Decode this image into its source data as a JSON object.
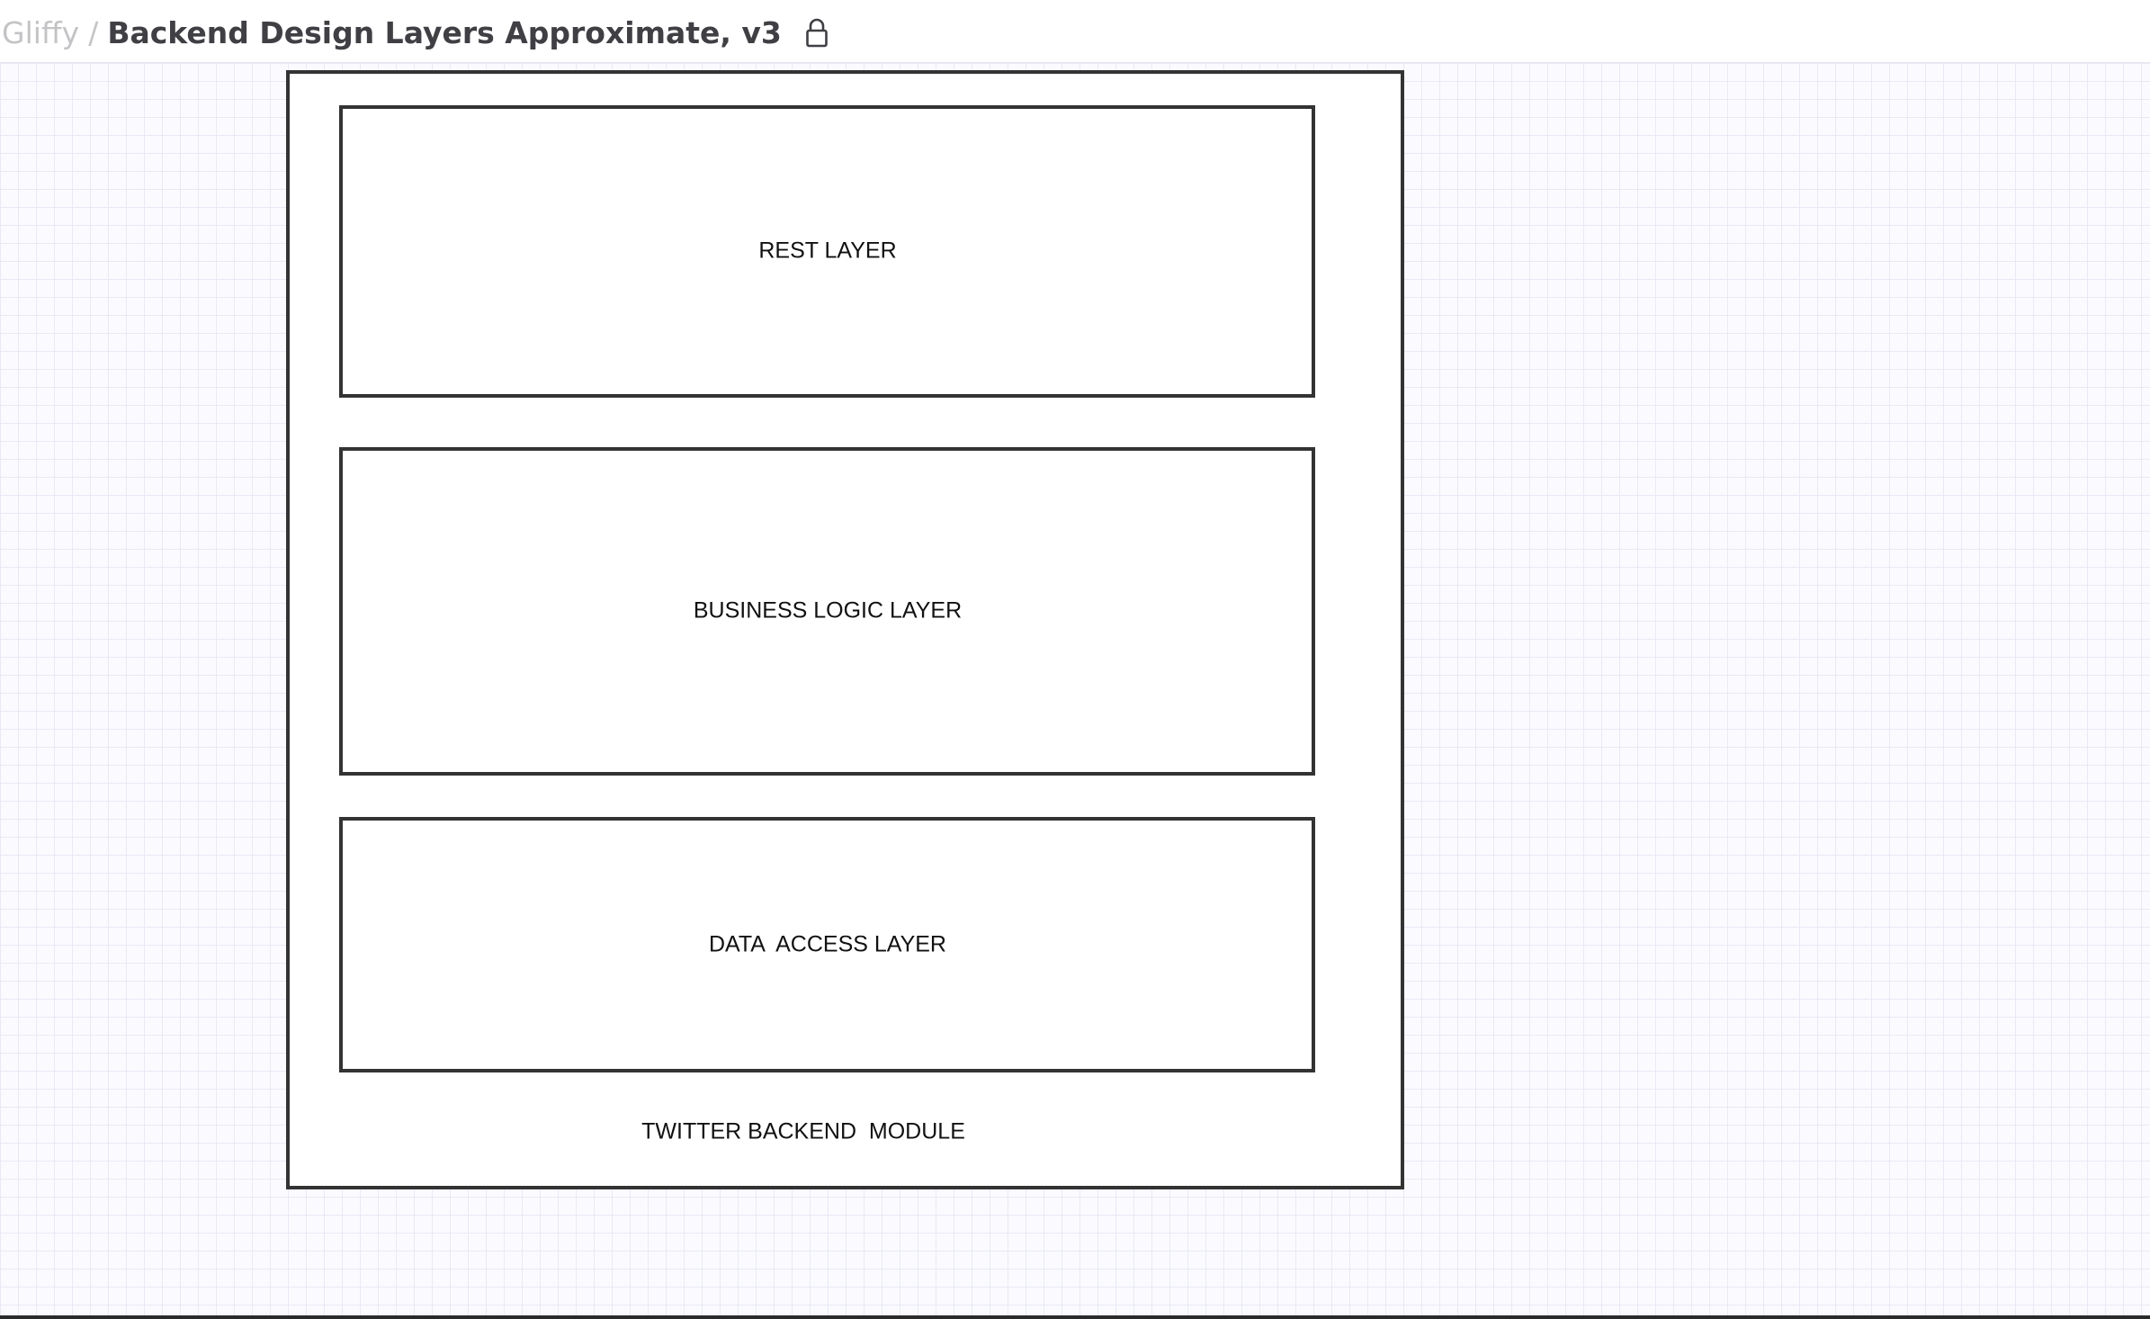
{
  "header": {
    "root_label": "Gliffy",
    "separator": "/",
    "title": "Backend Design Layers Approximate, v3",
    "lock_icon": "lock-icon"
  },
  "diagram": {
    "module_label": "TWITTER BACKEND  MODULE",
    "layers": [
      {
        "label": "REST LAYER"
      },
      {
        "label": "BUSINESS LOGIC LAYER"
      },
      {
        "label": "DATA  ACCESS LAYER"
      }
    ]
  },
  "colors": {
    "canvas_background": "#fbfbff",
    "grid_line": "#e9e9f6",
    "shape_border": "#333333",
    "title_text": "#3f3f44",
    "breadcrumb_muted": "#c4c4c7"
  }
}
